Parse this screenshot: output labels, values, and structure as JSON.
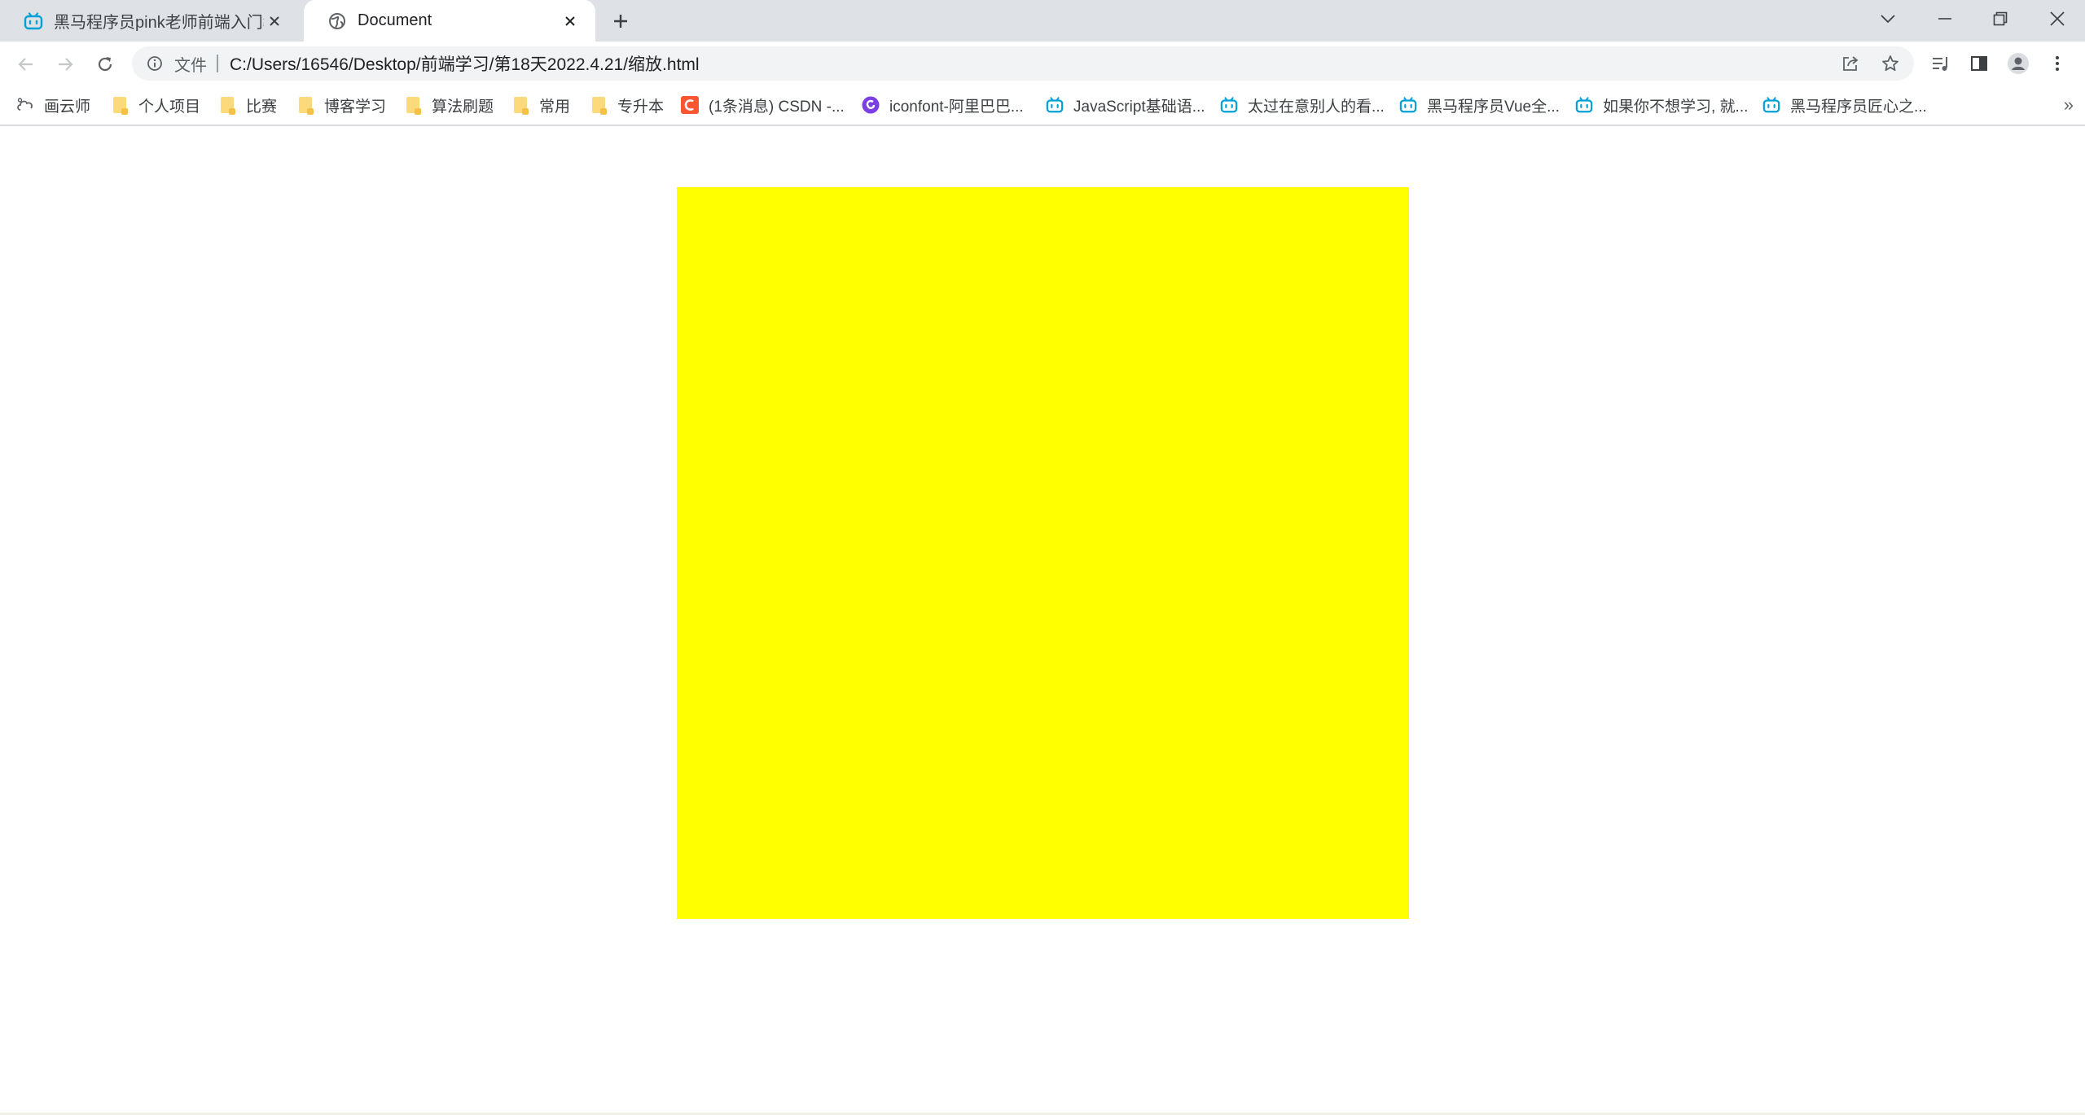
{
  "browser": {
    "tabs": [
      {
        "label": "黑马程序员pink老师前端入门教程",
        "active": false,
        "favicon": "bilibili-icon"
      },
      {
        "label": "Document",
        "active": true,
        "favicon": "globe-icon"
      }
    ],
    "address": {
      "scheme_label": "文件",
      "url": "C:/Users/16546/Desktop/前端学习/第18天2022.4.21/缩放.html"
    },
    "bookmarks": [
      {
        "label": "画云师",
        "icon": "cloud-icon"
      },
      {
        "label": "个人项目",
        "icon": "folder-icon"
      },
      {
        "label": "比赛",
        "icon": "folder-icon"
      },
      {
        "label": "博客学习",
        "icon": "folder-icon"
      },
      {
        "label": "算法刷题",
        "icon": "folder-icon"
      },
      {
        "label": "常用",
        "icon": "folder-icon"
      },
      {
        "label": "专升本",
        "icon": "folder-icon"
      },
      {
        "label": "(1条消息) CSDN -...",
        "icon": "csdn-icon"
      },
      {
        "label": "iconfont-阿里巴巴...",
        "icon": "iconfont-icon"
      },
      {
        "label": "JavaScript基础语...",
        "icon": "bilibili-icon"
      },
      {
        "label": "太过在意别人的看...",
        "icon": "bilibili-icon"
      },
      {
        "label": "黑马程序员Vue全...",
        "icon": "bilibili-icon"
      },
      {
        "label": "如果你不想学习, 就...",
        "icon": "bilibili-icon"
      },
      {
        "label": "黑马程序员匠心之...",
        "icon": "bilibili-icon"
      }
    ],
    "overflow_label": "»"
  },
  "page": {
    "box_color": "#ffff00"
  },
  "colors": {
    "tabstrip_bg": "#dee1e6",
    "omnibox_bg": "#f1f3f4",
    "bilibili_blue": "#00a1d6",
    "csdn_red": "#fc5531"
  }
}
